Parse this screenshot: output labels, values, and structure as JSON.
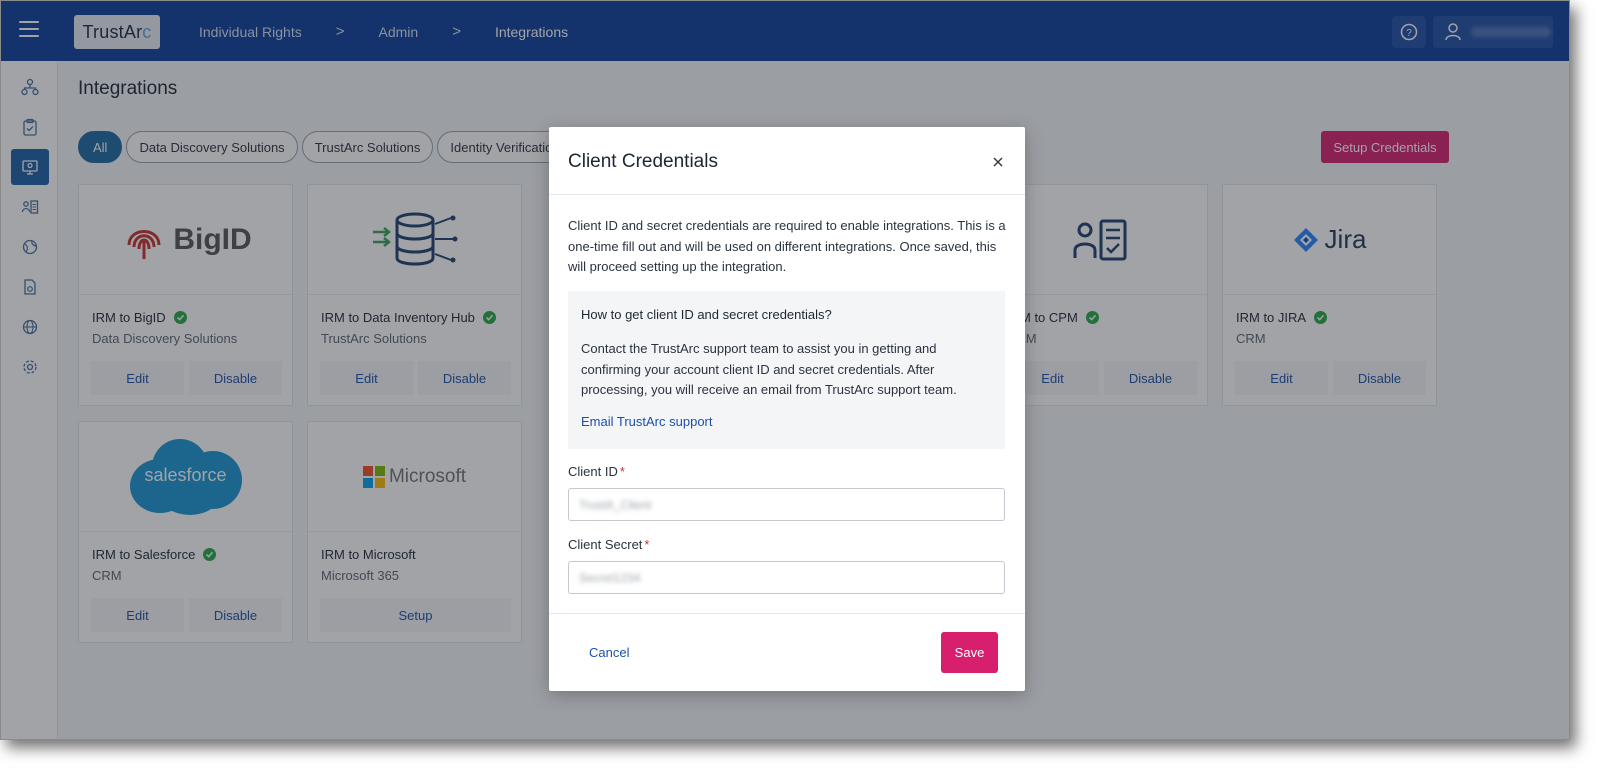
{
  "header": {
    "logo_text": "TrustArc",
    "breadcrumbs": [
      "Individual Rights",
      "Admin",
      "Integrations"
    ],
    "breadcrumb_separator": ">",
    "user_name": "Loretta Riley"
  },
  "page": {
    "title": "Integrations",
    "filters": [
      "All",
      "Data Discovery Solutions",
      "TrustArc Solutions",
      "Identity Verification"
    ],
    "setup_credentials_label": "Setup Credentials"
  },
  "cards": [
    {
      "name": "IRM to BigID",
      "category": "Data Discovery Solutions",
      "connected": true,
      "actions": [
        "Edit",
        "Disable"
      ],
      "logo_text": "BigID"
    },
    {
      "name": "IRM to Data Inventory Hub",
      "category": "TrustArc Solutions",
      "connected": true,
      "actions": [
        "Edit",
        "Disable"
      ]
    },
    {
      "name": "IRM to CPM",
      "category": "CRM",
      "connected": true,
      "actions": [
        "Edit",
        "Disable"
      ]
    },
    {
      "name": "IRM to JIRA",
      "category": "CRM",
      "connected": true,
      "actions": [
        "Edit",
        "Disable"
      ],
      "logo_text": "Jira"
    },
    {
      "name": "IRM to Salesforce",
      "category": "CRM",
      "connected": true,
      "actions": [
        "Edit",
        "Disable"
      ],
      "logo_text": "salesforce"
    },
    {
      "name": "IRM to Microsoft",
      "category": "Microsoft 365",
      "connected": false,
      "actions": [
        "Setup"
      ],
      "logo_text": "Microsoft"
    }
  ],
  "modal": {
    "title": "Client Credentials",
    "close_icon": "close-icon",
    "intro": "Client ID and secret credentials are required to enable integrations. This is a one-time fill out and will be used on different integrations. Once saved, this will proceed setting up the integration.",
    "howto_title": "How to get client ID and secret credentials?",
    "howto_text": "Contact the TrustArc support team to assist you in getting and confirming your account client ID and secret credentials. After processing, you will receive an email from TrustArc support team.",
    "howto_link": "Email TrustArc support",
    "client_id_label": "Client ID",
    "client_id_value": "TrustA_Client",
    "client_secret_label": "Client Secret",
    "client_secret_value": "Secret1234",
    "required_mark": "*",
    "cancel_label": "Cancel",
    "save_label": "Save"
  },
  "colors": {
    "topbar": "#0d3f99",
    "accent_pink": "#d71f6e",
    "link_blue": "#1d50a5",
    "check_green": "#27a844"
  }
}
